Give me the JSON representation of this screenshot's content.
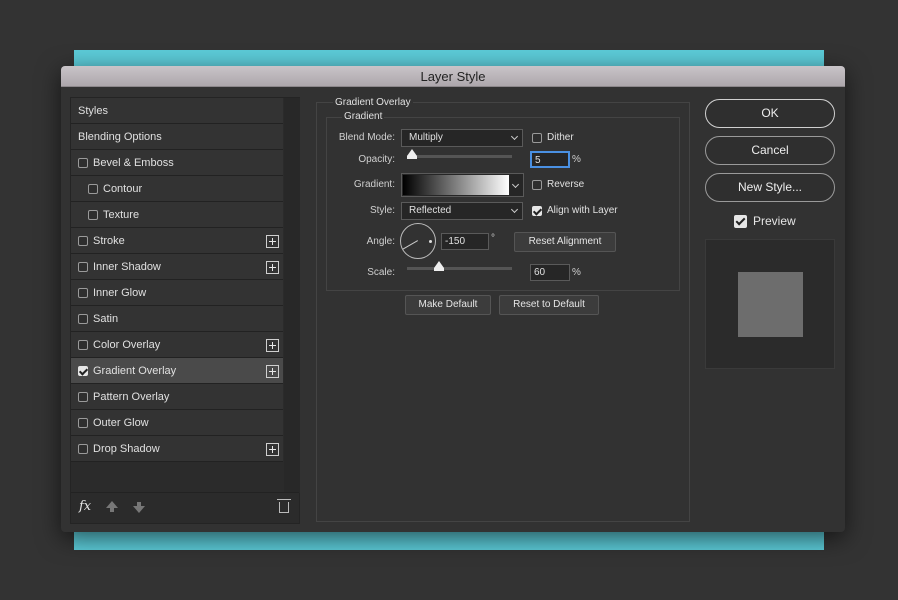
{
  "window": {
    "title": "Layer Style"
  },
  "styles": [
    {
      "label": "Styles",
      "checkbox": false,
      "indent": false,
      "plus": false,
      "checked": false,
      "active": false
    },
    {
      "label": "Blending Options",
      "checkbox": false,
      "indent": false,
      "plus": false,
      "checked": false,
      "active": false
    },
    {
      "label": "Bevel & Emboss",
      "checkbox": true,
      "indent": false,
      "plus": false,
      "checked": false,
      "active": false
    },
    {
      "label": "Contour",
      "checkbox": true,
      "indent": true,
      "plus": false,
      "checked": false,
      "active": false
    },
    {
      "label": "Texture",
      "checkbox": true,
      "indent": true,
      "plus": false,
      "checked": false,
      "active": false
    },
    {
      "label": "Stroke",
      "checkbox": true,
      "indent": false,
      "plus": true,
      "checked": false,
      "active": false
    },
    {
      "label": "Inner Shadow",
      "checkbox": true,
      "indent": false,
      "plus": true,
      "checked": false,
      "active": false
    },
    {
      "label": "Inner Glow",
      "checkbox": true,
      "indent": false,
      "plus": false,
      "checked": false,
      "active": false
    },
    {
      "label": "Satin",
      "checkbox": true,
      "indent": false,
      "plus": false,
      "checked": false,
      "active": false
    },
    {
      "label": "Color Overlay",
      "checkbox": true,
      "indent": false,
      "plus": true,
      "checked": false,
      "active": false
    },
    {
      "label": "Gradient Overlay",
      "checkbox": true,
      "indent": false,
      "plus": true,
      "checked": true,
      "active": true
    },
    {
      "label": "Pattern Overlay",
      "checkbox": true,
      "indent": false,
      "plus": false,
      "checked": false,
      "active": false
    },
    {
      "label": "Outer Glow",
      "checkbox": true,
      "indent": false,
      "plus": false,
      "checked": false,
      "active": false
    },
    {
      "label": "Drop Shadow",
      "checkbox": true,
      "indent": false,
      "plus": true,
      "checked": false,
      "active": false
    }
  ],
  "footer": {
    "fx_label": "fx"
  },
  "panel": {
    "title": "Gradient Overlay",
    "subtitle": "Gradient",
    "blend_mode_label": "Blend Mode:",
    "blend_mode_value": "Multiply",
    "dither_label": "Dither",
    "dither_checked": false,
    "opacity_label": "Opacity:",
    "opacity_value": "5",
    "opacity_unit": "%",
    "opacity_fraction": 0.05,
    "gradient_label": "Gradient:",
    "gradient_colors": [
      "#000000",
      "#ffffff"
    ],
    "reverse_label": "Reverse",
    "reverse_checked": false,
    "style_label": "Style:",
    "style_value": "Reflected",
    "align_label": "Align with Layer",
    "align_checked": true,
    "angle_label": "Angle:",
    "angle_value": "-150",
    "angle_unit": "°",
    "reset_alignment_label": "Reset Alignment",
    "scale_label": "Scale:",
    "scale_value": "60",
    "scale_unit": "%",
    "scale_fraction": 0.3,
    "make_default_label": "Make Default",
    "reset_default_label": "Reset to Default"
  },
  "actions": {
    "ok_label": "OK",
    "cancel_label": "Cancel",
    "new_style_label": "New Style...",
    "preview_label": "Preview",
    "preview_checked": true
  },
  "colors": {
    "accent": "#4a90e2",
    "backdrop": "#5ccbd8"
  }
}
